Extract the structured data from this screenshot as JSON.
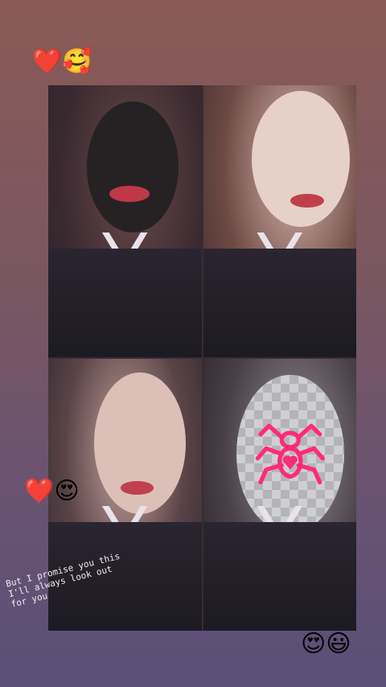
{
  "story": {
    "caption": "But I promise you this\nI'll always look out\nfor you",
    "emojis": {
      "top": "❤️🥰",
      "middle": "❤️😍",
      "bottom": "😍😃"
    }
  },
  "icons": [
    "heart-icon",
    "smiling-hearts-face-icon",
    "heart-eyes-face-icon",
    "grinning-face-icon",
    "spider-sticker-icon"
  ],
  "colors": {
    "accent": "#ff2a7a",
    "lip": "#c03848"
  }
}
